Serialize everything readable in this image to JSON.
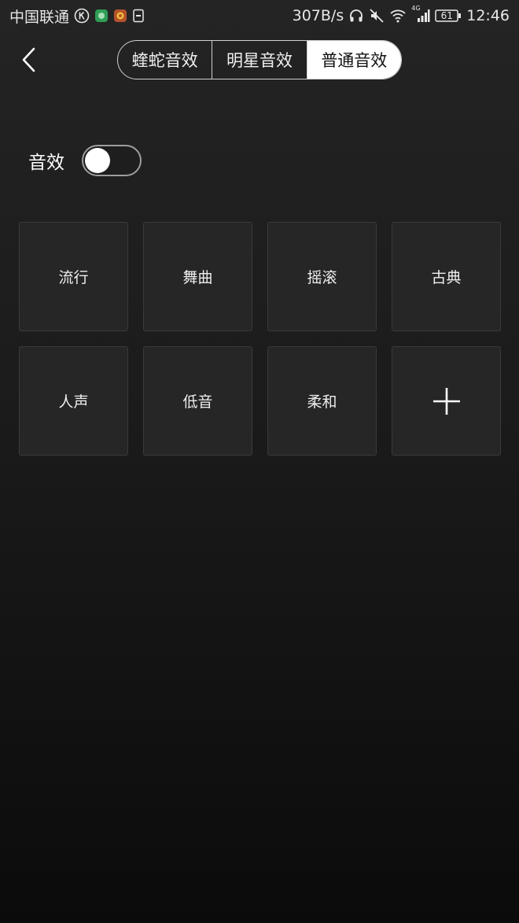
{
  "status_bar": {
    "carrier": "中国联通",
    "net_speed": "307B/s",
    "battery": "61",
    "time": "12:46",
    "network_type": "4G",
    "icons": [
      "k-circle-icon",
      "green-app-icon",
      "orange-app-icon",
      "sim-icon",
      "headphones-icon",
      "mute-icon",
      "wifi-icon",
      "signal-icon",
      "battery-icon"
    ]
  },
  "header": {
    "back_icon": "chevron-left-icon",
    "tabs": [
      {
        "label": "蝰蛇音效",
        "active": false
      },
      {
        "label": "明星音效",
        "active": false
      },
      {
        "label": "普通音效",
        "active": true
      }
    ]
  },
  "effect_toggle": {
    "label": "音效",
    "on": false
  },
  "presets": {
    "items": [
      {
        "label": "流行"
      },
      {
        "label": "舞曲"
      },
      {
        "label": "摇滚"
      },
      {
        "label": "古典"
      },
      {
        "label": "人声"
      },
      {
        "label": "低音"
      },
      {
        "label": "柔和"
      }
    ],
    "add_icon": "plus-icon"
  },
  "colors": {
    "background_top": "#242424",
    "background_bottom": "#0b0b0b",
    "tile": "#262626",
    "active_tab": "#ffffff"
  }
}
